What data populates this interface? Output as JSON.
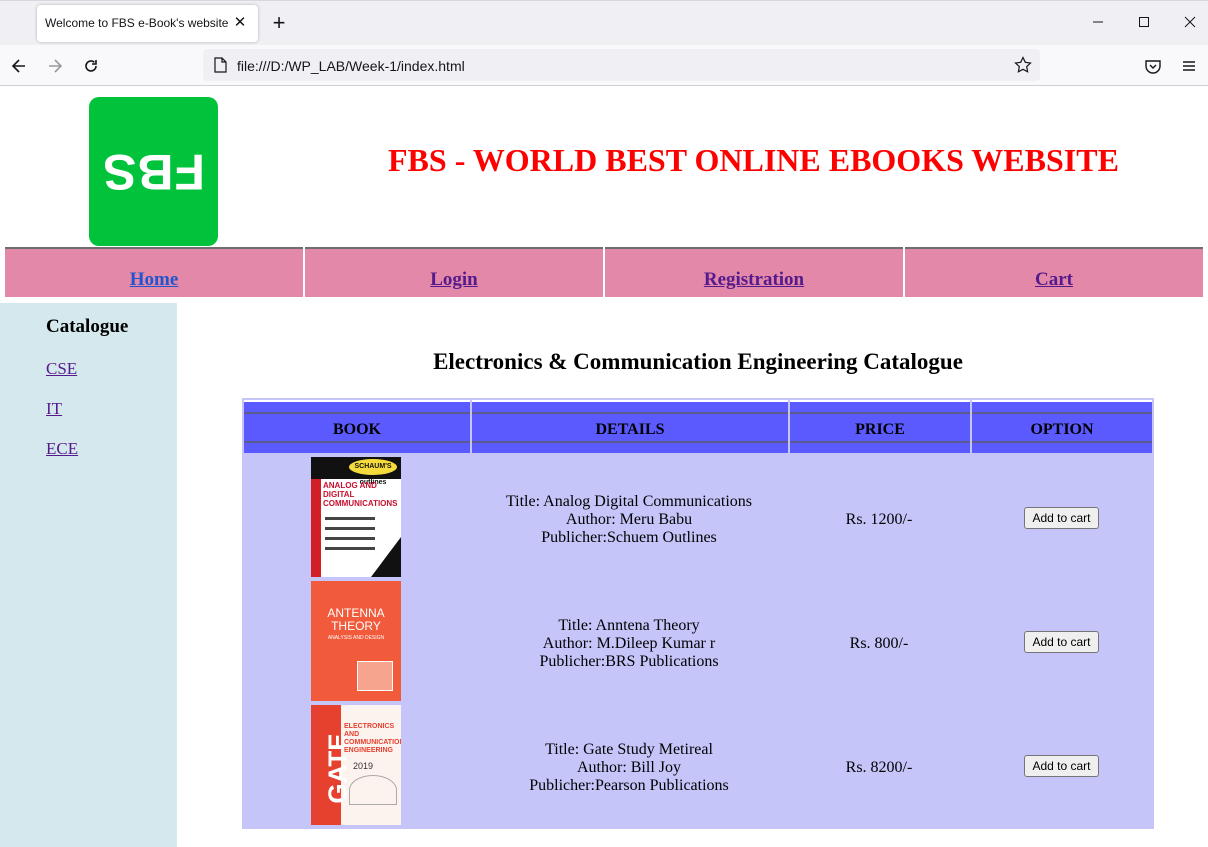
{
  "browser": {
    "tab_title": "Welcome to FBS e-Book's website",
    "url": "file:///D:/WP_LAB/Week-1/index.html"
  },
  "site": {
    "logo_text": "FBS",
    "title": "FBS - WORLD BEST ONLINE EBOOKS WEBSITE"
  },
  "menu": {
    "items": [
      {
        "label": "Home"
      },
      {
        "label": "Login"
      },
      {
        "label": "Registration"
      },
      {
        "label": "Cart"
      }
    ]
  },
  "sidebar": {
    "heading": "Catalogue",
    "links": [
      {
        "label": "CSE"
      },
      {
        "label": "IT"
      },
      {
        "label": "ECE"
      }
    ]
  },
  "catalogue": {
    "title": "Electronics & Communication Engineering Catalogue",
    "columns": [
      "BOOK",
      "DETAILS",
      "PRICE",
      "OPTION"
    ],
    "rows": [
      {
        "title": "Title: Analog Digital Communications",
        "author": "Author: Meru Babu",
        "publisher": "Publicher:Schuem Outlines",
        "price": "Rs. 1200/-",
        "button": "Add to cart",
        "cover": {
          "top": "SCHAUM'S outlines",
          "title": "ANALOG AND DIGITAL COMMUNICATIONS"
        }
      },
      {
        "title": "Title: Anntena Theory",
        "author": "Author: M.Dileep Kumar r",
        "publisher": "Publicher:BRS Publications",
        "price": "Rs. 800/-",
        "button": "Add to cart",
        "cover": {
          "title": "ANTENNA THEORY",
          "subtitle": "ANALYSIS AND DESIGN"
        }
      },
      {
        "title": "Title: Gate Study Metireal",
        "author": "Author: Bill Joy",
        "publisher": "Publicher:Pearson Publications",
        "price": "Rs. 8200/-",
        "button": "Add to cart",
        "cover": {
          "side": "GATE",
          "title": "ELECTRONICS AND COMMUNICATION ENGINEERING",
          "year": "2019"
        }
      }
    ]
  },
  "colors": {
    "title_red": "#ff0000",
    "menu_pink": "#e388a8",
    "sidebar_blue": "#d5e8ee",
    "header_blue": "#5a5aff",
    "table_lavender": "#c5c5fa",
    "logo_green": "#00c33b"
  },
  "icons": {
    "back": "arrow-left-icon",
    "forward": "arrow-right-icon",
    "reload": "reload-icon",
    "page": "page-icon",
    "bookmark": "star-icon",
    "pocket": "pocket-icon",
    "menu": "hamburger-icon"
  }
}
